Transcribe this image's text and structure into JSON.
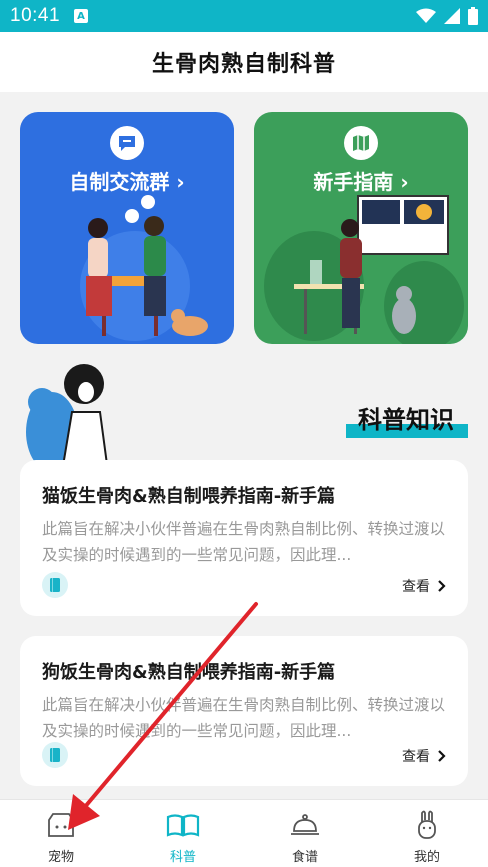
{
  "status_bar": {
    "time": "10:41",
    "notif_glyph": "A"
  },
  "header": {
    "title": "生骨肉熟自制科普"
  },
  "cards": {
    "group": {
      "label": "自制交流群 ›",
      "color": "#2e6fe0"
    },
    "guide": {
      "label": "新手指南 ›",
      "color": "#3c9f5a"
    }
  },
  "section": {
    "title": "科普知识",
    "accent": "#0fb5c7"
  },
  "articles": [
    {
      "title": "猫饭生骨肉&熟自制喂养指南-新手篇",
      "desc": "此篇旨在解决小伙伴普遍在生骨肉熟自制比例、转换过渡以及实操的时候遇到的一些常见问题，因此理...",
      "view": "查看"
    },
    {
      "title": "狗饭生骨肉&熟自制喂养指南-新手篇",
      "desc": "此篇旨在解决小伙伴普遍在生骨肉熟自制比例、转换过渡以及实操的时候遇到的一些常见问题，因此理...",
      "view": "查看"
    }
  ],
  "tabbar": {
    "items": [
      {
        "label": "宠物",
        "icon": "pet-house-icon"
      },
      {
        "label": "科普",
        "icon": "open-book-icon",
        "active": true
      },
      {
        "label": "食谱",
        "icon": "food-cloche-icon"
      },
      {
        "label": "我的",
        "icon": "rabbit-profile-icon"
      }
    ]
  },
  "annotation": {
    "arrow_color": "#e0242b"
  }
}
